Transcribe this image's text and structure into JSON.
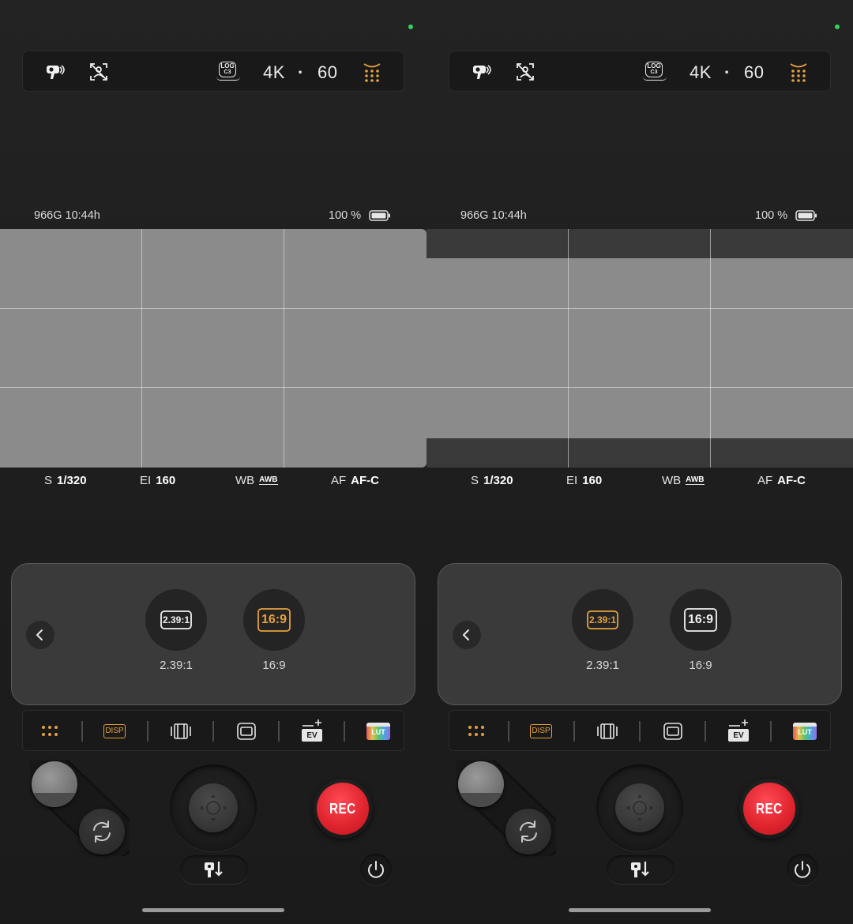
{
  "colors": {
    "accent": "#e5a13b",
    "rec_red": "#e1252f",
    "status_dot": "#2fd15a",
    "background": "#1e1e1e"
  },
  "screens": [
    {
      "id": "left",
      "top_bar": {
        "icons": [
          "camera-person-icon",
          "tracking-off-icon",
          "log-c3-icon",
          "grid-menu-icon"
        ],
        "log_label_top": "LOG",
        "log_label_bottom": "C3",
        "resolution": "4K",
        "separator": "·",
        "fps": "60"
      },
      "info": {
        "storage": "966G  10:44h",
        "battery": "100 %"
      },
      "viewfinder": {
        "letterbox": false
      },
      "params": {
        "shutter_label": "S",
        "shutter_value": "1/320",
        "ei_label": "EI",
        "ei_value": "160",
        "wb_label": "WB",
        "wb_value": "AWB",
        "af_label": "AF",
        "af_value": "AF-C"
      },
      "aspect_popup": {
        "options": [
          {
            "icon_text": "2.39:1",
            "label": "2.39:1",
            "selected": false
          },
          {
            "icon_text": "16:9",
            "label": "16:9",
            "selected": true
          }
        ]
      },
      "tools": [
        "grid-menu-icon",
        "disp-icon",
        "film-gate-icon",
        "frame-icon",
        "ev-icon",
        "lut-icon"
      ],
      "tool_labels": {
        "disp": "DISP",
        "ev": "EV",
        "lut": "LUT"
      },
      "rec_label": "REC"
    },
    {
      "id": "right",
      "top_bar": {
        "icons": [
          "camera-person-icon",
          "tracking-off-icon",
          "log-c3-icon",
          "grid-menu-icon"
        ],
        "log_label_top": "LOG",
        "log_label_bottom": "C3",
        "resolution": "4K",
        "separator": "·",
        "fps": "60"
      },
      "info": {
        "storage": "966G  10:44h",
        "battery": "100 %"
      },
      "viewfinder": {
        "letterbox": true
      },
      "params": {
        "shutter_label": "S",
        "shutter_value": "1/320",
        "ei_label": "EI",
        "ei_value": "160",
        "wb_label": "WB",
        "wb_value": "AWB",
        "af_label": "AF",
        "af_value": "AF-C"
      },
      "aspect_popup": {
        "options": [
          {
            "icon_text": "2.39:1",
            "label": "2.39:1",
            "selected": true
          },
          {
            "icon_text": "16:9",
            "label": "16:9",
            "selected": false
          }
        ]
      },
      "tools": [
        "grid-menu-icon",
        "disp-icon",
        "film-gate-icon",
        "frame-icon",
        "ev-icon",
        "lut-icon"
      ],
      "tool_labels": {
        "disp": "DISP",
        "ev": "EV",
        "lut": "LUT"
      },
      "rec_label": "REC"
    }
  ]
}
